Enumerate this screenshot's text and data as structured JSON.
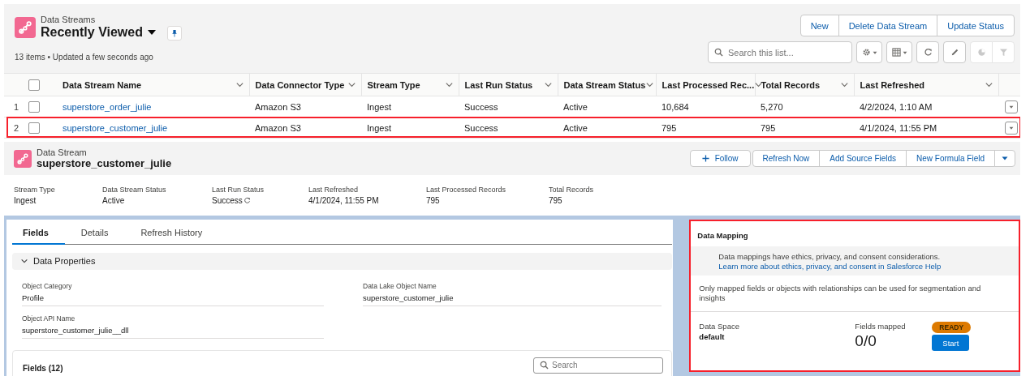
{
  "list_view": {
    "object_label": "Data Streams",
    "title": "Recently Viewed",
    "status": "13 items • Updated a few seconds ago",
    "buttons": [
      "New",
      "Delete Data Stream",
      "Update Status"
    ],
    "search": {
      "placeholder": "Search this list..."
    }
  },
  "table": {
    "select_all": {
      "checked": false
    },
    "columns": [
      "Data Stream Name",
      "Data Connector Type",
      "Stream Type",
      "Last Run Status",
      "Data Stream Status",
      "Last Processed Rec...",
      "Total Records",
      "Last Refreshed"
    ],
    "rows": [
      {
        "number": "1",
        "selected": false,
        "highlighted": false,
        "cells": [
          "superstore_order_julie",
          "Amazon S3",
          "Ingest",
          "Success",
          "Active",
          "10,684",
          "5,270",
          "4/2/2024, 1:10 AM"
        ]
      },
      {
        "number": "2",
        "selected": false,
        "highlighted": true,
        "cells": [
          "superstore_customer_julie",
          "Amazon S3",
          "Ingest",
          "Success",
          "Active",
          "795",
          "795",
          "4/1/2024, 11:55 PM"
        ]
      }
    ]
  },
  "record": {
    "object_label": "Data Stream",
    "title": "superstore_customer_julie",
    "follow_button": "Follow",
    "buttons": [
      "Refresh Now",
      "Add Source Fields",
      "New Formula Field"
    ],
    "highlights": [
      {
        "label": "Stream Type",
        "value": "Ingest",
        "refresh": false
      },
      {
        "label": "Data Stream Status",
        "value": "Active",
        "refresh": false
      },
      {
        "label": "Last Run Status",
        "value": "Success",
        "refresh": true
      },
      {
        "label": "Last Refreshed",
        "value": "4/1/2024, 11:55 PM",
        "refresh": false
      },
      {
        "label": "Last Processed Records",
        "value": "795",
        "refresh": false
      },
      {
        "label": "Total Records",
        "value": "795",
        "refresh": false
      }
    ]
  },
  "tabs": [
    {
      "label": "Fields",
      "selected": true
    },
    {
      "label": "Details",
      "selected": false
    },
    {
      "label": "Refresh History",
      "selected": false
    }
  ],
  "section": {
    "title": "Data Properties",
    "expanded": true,
    "fields": [
      {
        "label": "Object Category",
        "value": "Profile"
      },
      {
        "label": "Data Lake Object Name",
        "value": "superstore_customer_julie"
      },
      {
        "label": "Object API Name",
        "value": "superstore_customer_julie__dll"
      }
    ]
  },
  "fields_card": {
    "title": "Fields (12)",
    "search": {
      "placeholder": "Search"
    }
  },
  "data_mapping": {
    "title": "Data Mapping",
    "highlighted": true,
    "notice": "Data mappings have ethics, privacy, and consent considerations.",
    "notice_link": "Learn more about ethics, privacy, and consent in Salesforce Help",
    "info": "Only mapped fields or objects with relationships can be used for segmentation and insights",
    "data_space_label": "Data Space",
    "data_space": "default",
    "fields_mapped_label": "Fields mapped",
    "fields_mapped": "0/0",
    "status": "READY",
    "button": "Start"
  }
}
